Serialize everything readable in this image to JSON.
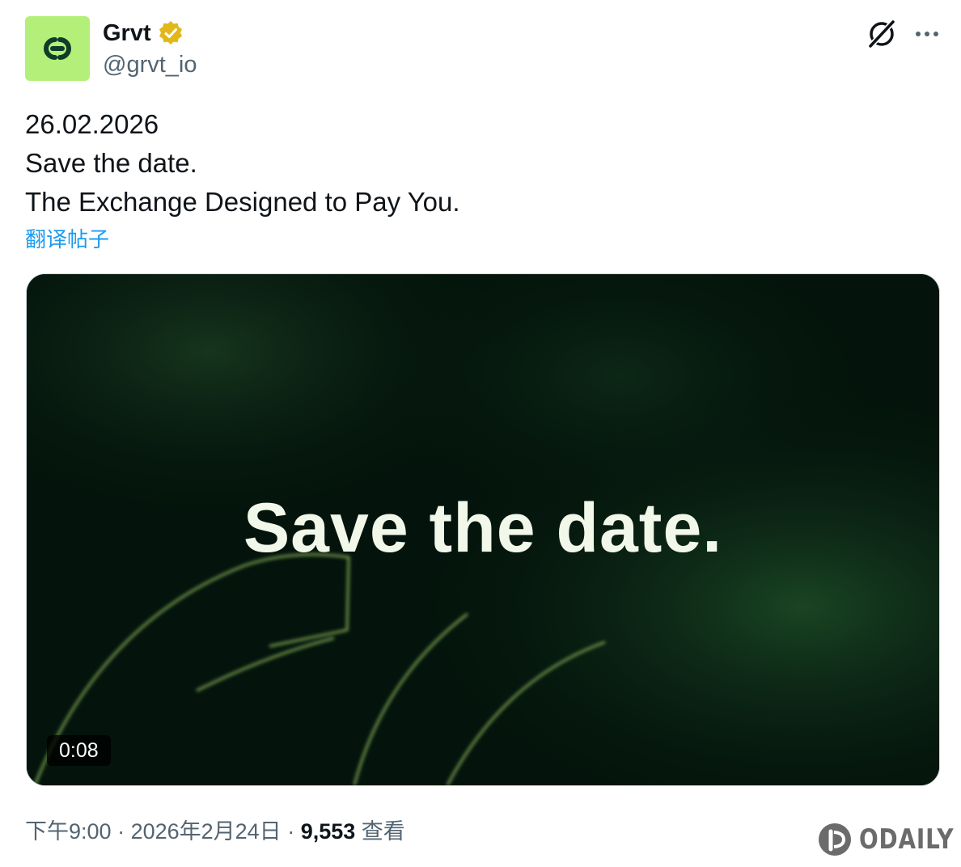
{
  "author": {
    "name": "Grvt",
    "handle": "@grvt_io",
    "avatar_color": "#b3ef79",
    "verified_color": "#e2b719"
  },
  "header_actions": {
    "grok_icon": "grok-icon",
    "more_icon": "more-icon"
  },
  "tweet": {
    "lines": [
      "26.02.2026",
      "Save the date.",
      "The Exchange Designed to Pay You."
    ],
    "translate_label": "翻译帖子"
  },
  "media": {
    "overlay_text": "Save the date.",
    "duration": "0:08"
  },
  "meta": {
    "time": "下午9:00",
    "separator": " · ",
    "date": "2026年2月24日",
    "views_count": "9,553",
    "views_label": " 查看"
  },
  "watermark": {
    "text": "ODAILY"
  }
}
